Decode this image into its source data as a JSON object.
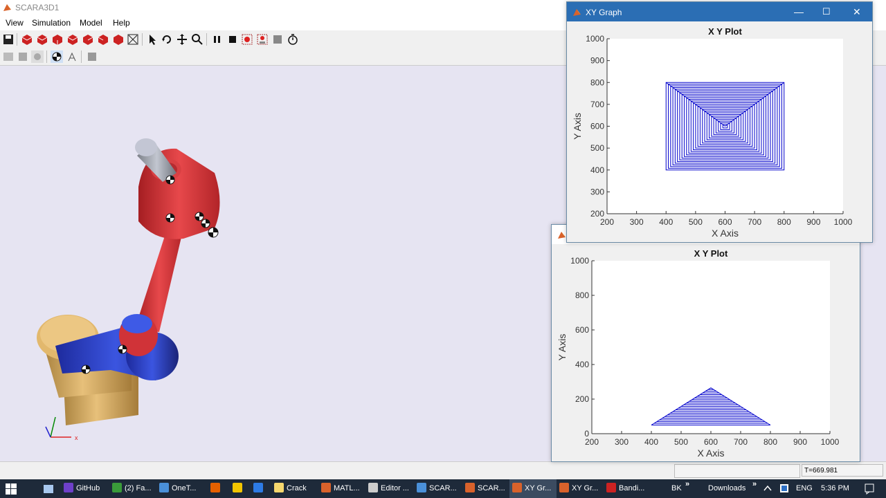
{
  "app": {
    "title": "SCARA3D1",
    "menu": [
      "View",
      "Simulation",
      "Model",
      "Help"
    ],
    "status_time": "T=669.981"
  },
  "window1": {
    "title": "XY Graph",
    "minimize": "—",
    "maximize": "☐",
    "close": "✕"
  },
  "chart_data": [
    {
      "type": "line",
      "title": "X Y Plot",
      "xlabel": "X Axis",
      "ylabel": "Y Axis",
      "xlim": [
        200,
        1000
      ],
      "ylim": [
        200,
        1000
      ],
      "xticks": [
        "200",
        "300",
        "400",
        "500",
        "600",
        "700",
        "800",
        "900",
        "1000"
      ],
      "yticks": [
        "200",
        "300",
        "400",
        "500",
        "600",
        "700",
        "800",
        "900",
        "1000"
      ],
      "color": "#0000cc",
      "shape": "concentric-squares",
      "outer_x": [
        400,
        800
      ],
      "outer_y": [
        400,
        800
      ],
      "center": [
        600,
        600
      ],
      "grid": false
    },
    {
      "type": "line",
      "title": "X Y Plot",
      "xlabel": "X Axis",
      "ylabel": "Y Axis",
      "xlim": [
        200,
        1000
      ],
      "ylim": [
        0,
        1000
      ],
      "xticks": [
        "200",
        "300",
        "400",
        "500",
        "600",
        "700",
        "800",
        "900",
        "1000"
      ],
      "yticks": [
        "0",
        "200",
        "400",
        "600",
        "800",
        "1000"
      ],
      "color": "#0000cc",
      "shape": "triangle-fill",
      "base_x": [
        400,
        800
      ],
      "base_y": 50,
      "apex": [
        600,
        265
      ],
      "grid": false
    }
  ],
  "taskbar": {
    "items": [
      {
        "label": "GitHub",
        "color": "#6e40c9"
      },
      {
        "label": "(2) Fa...",
        "color": "#3a9b3a"
      },
      {
        "label": "OneT...",
        "color": "#4a90d9"
      },
      {
        "label": "",
        "color": "#e66000"
      },
      {
        "label": "",
        "color": "#f2c500"
      },
      {
        "label": "",
        "color": "#2d7be5"
      },
      {
        "label": "Crack",
        "color": "#f5d76e"
      },
      {
        "label": "MATL...",
        "color": "#d9622b"
      },
      {
        "label": "Editor ...",
        "color": "#cccccc"
      },
      {
        "label": "SCAR...",
        "color": "#4a90d9"
      },
      {
        "label": "SCAR...",
        "color": "#d9622b"
      },
      {
        "label": "XY Gr...",
        "color": "#d9622b"
      },
      {
        "label": "XY Gr...",
        "color": "#d9622b"
      },
      {
        "label": "Bandi...",
        "color": "#cc2222"
      }
    ],
    "lang_short": "BK",
    "downloads": "Downloads",
    "chevron": "»",
    "lang": "ENG",
    "time": "5:36 PM"
  }
}
